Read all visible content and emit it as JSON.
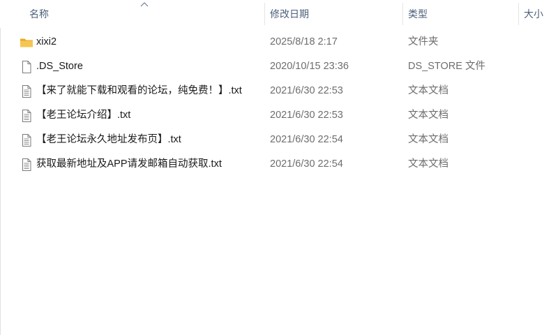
{
  "columns": {
    "name": "名称",
    "date": "修改日期",
    "type": "类型",
    "size": "大小"
  },
  "files": [
    {
      "name": "xixi2",
      "date": "2025/8/18 2:17",
      "type": "文件夹",
      "icon": "folder-icon"
    },
    {
      "name": ".DS_Store",
      "date": "2020/10/15 23:36",
      "type": "DS_STORE 文件",
      "icon": "blank-file-icon"
    },
    {
      "name": "【来了就能下载和观看的论坛，纯免费！】.txt",
      "date": "2021/6/30 22:53",
      "type": "文本文档",
      "icon": "text-file-icon"
    },
    {
      "name": "【老王论坛介绍】.txt",
      "date": "2021/6/30 22:53",
      "type": "文本文档",
      "icon": "text-file-icon"
    },
    {
      "name": "【老王论坛永久地址发布页】.txt",
      "date": "2021/6/30 22:54",
      "type": "文本文档",
      "icon": "text-file-icon"
    },
    {
      "name": "获取最新地址及APP请发邮箱自动获取.txt",
      "date": "2021/6/30 22:54",
      "type": "文本文档",
      "icon": "text-file-icon"
    }
  ],
  "colors": {
    "header_text": "#4c607a",
    "secondary_text": "#6d6d6d",
    "folder": "#f3c14b"
  }
}
